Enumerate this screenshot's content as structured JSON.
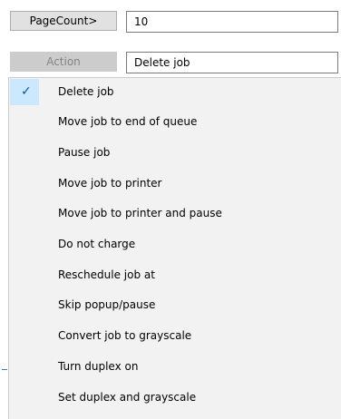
{
  "rule": {
    "condition_button": "PageCount>",
    "condition_value": "10",
    "action_button": "Action",
    "action_value": "Delete job"
  },
  "menu": {
    "selected_index": 0,
    "check_glyph": "✓",
    "items": [
      "Delete job",
      "Move job to end of queue",
      "Pause job",
      "Move job to printer",
      "Move job to printer and pause",
      "Do not charge",
      "Reschedule job at",
      "Skip popup/pause",
      "Convert job to grayscale",
      "Turn duplex on",
      "Set duplex and grayscale"
    ]
  },
  "icons": {
    "checkmark": "checkmark-icon"
  },
  "colors": {
    "selection_highlight": "#cce8ff",
    "menu_background": "#f2f2f2",
    "checkmark": "#005a9e"
  }
}
